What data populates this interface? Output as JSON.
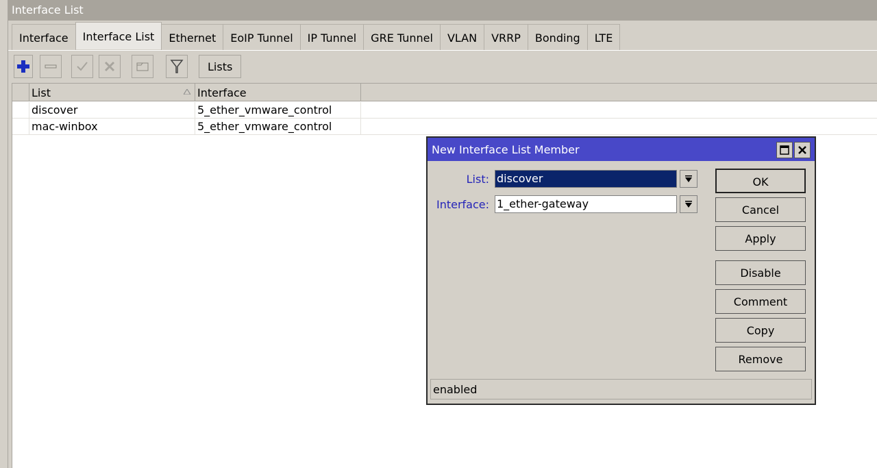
{
  "window": {
    "title": "Interface List"
  },
  "tabs": [
    "Interface",
    "Interface List",
    "Ethernet",
    "EoIP Tunnel",
    "IP Tunnel",
    "GRE Tunnel",
    "VLAN",
    "VRRP",
    "Bonding",
    "LTE"
  ],
  "toolbar": {
    "lists_label": "Lists"
  },
  "table": {
    "columns": [
      "List",
      "Interface"
    ],
    "rows": [
      {
        "list": "discover",
        "interface": "5_ether_vmware_control"
      },
      {
        "list": "mac-winbox",
        "interface": "5_ether_vmware_control"
      }
    ]
  },
  "dialog": {
    "title": "New Interface List Member",
    "list_label": "List:",
    "list_value": "discover",
    "interface_label": "Interface:",
    "interface_value": "1_ether-gateway",
    "buttons": {
      "ok": "OK",
      "cancel": "Cancel",
      "apply": "Apply",
      "disable": "Disable",
      "comment": "Comment",
      "copy": "Copy",
      "remove": "Remove"
    },
    "status": "enabled"
  },
  "colors": {
    "dialog_title": "#4848c8",
    "selected_field": "#0a246a",
    "label_blue": "#2424b8",
    "add_icon": "#1a2fc0"
  }
}
